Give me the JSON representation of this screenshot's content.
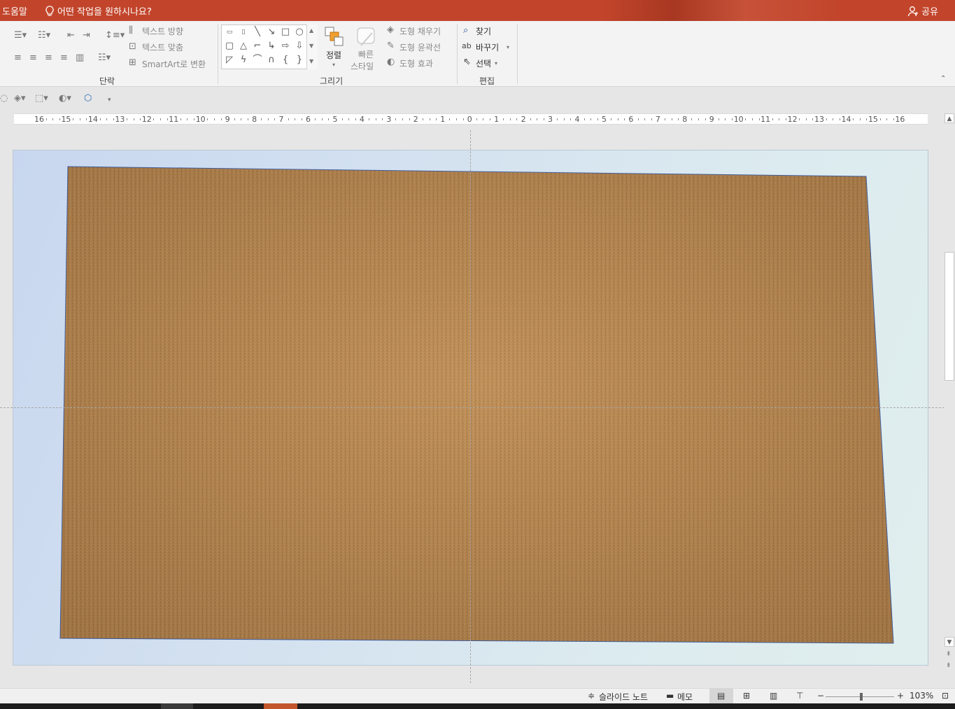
{
  "titlebar": {
    "help_label": "도움말",
    "tell_me": "어떤 작업을 원하시나요?",
    "share_label": "공유",
    "accent": "#c2452b"
  },
  "ribbon": {
    "paragraph": {
      "label": "단락",
      "text_direction": "텍스트 방향",
      "align_text": "텍스트 맞춤",
      "smartart": "SmartArt로 변환"
    },
    "drawing": {
      "label": "그리기",
      "arrange": "정렬",
      "quick_styles_line1": "빠른",
      "quick_styles_line2": "스타일",
      "shape_fill": "도형 채우기",
      "shape_outline": "도형 윤곽선",
      "shape_effects": "도형 효과"
    },
    "editing": {
      "label": "편집",
      "find": "찾기",
      "replace": "바꾸기",
      "select": "선택"
    }
  },
  "ruler": {
    "labels": [
      "16",
      "15",
      "14",
      "13",
      "12",
      "11",
      "10",
      "9",
      "8",
      "7",
      "6",
      "5",
      "4",
      "3",
      "2",
      "1",
      "0",
      "1",
      "2",
      "3",
      "4",
      "5",
      "6",
      "7",
      "8",
      "9",
      "10",
      "11",
      "12",
      "13",
      "14",
      "15",
      "16"
    ]
  },
  "slide": {
    "picture": "kraft-paper-texture",
    "paper_color": "#b98a55"
  },
  "statusbar": {
    "notes": "슬라이드 노트",
    "comments": "메모",
    "zoom": "103%",
    "zoom_fraction": 0.52
  }
}
